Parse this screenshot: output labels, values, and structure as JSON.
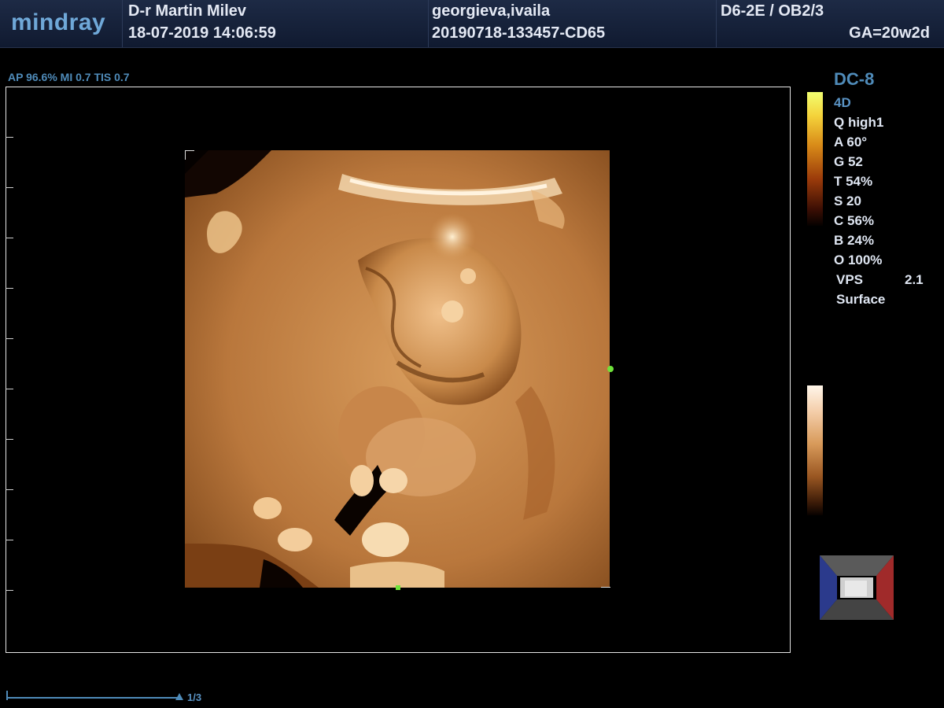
{
  "header": {
    "brand": "mindray",
    "operator": "D-r Martin Milev",
    "datetime": "18-07-2019  14:06:59",
    "patient_name": "georgieva,ivaila",
    "exam_id": "20190718-133457-CD65",
    "probe_preset": "D6-2E / OB2/3",
    "gestational_age": "GA=20w2d"
  },
  "acoustic_output": "AP 96.6%  MI 0.7 TIS 0.7",
  "parameters": {
    "probe": "DC-8",
    "items": [
      {
        "label": "4D",
        "value": ""
      },
      {
        "label": "Q high1",
        "value": ""
      },
      {
        "label": "A 60°",
        "value": ""
      },
      {
        "label": "G 52",
        "value": ""
      },
      {
        "label": "T 54%",
        "value": ""
      },
      {
        "label": "S 20",
        "value": ""
      },
      {
        "label": "C 56%",
        "value": ""
      },
      {
        "label": "B 24%",
        "value": ""
      },
      {
        "label": "O 100%",
        "value": ""
      },
      {
        "label": "VPS",
        "value": "2.1"
      },
      {
        "label": "Surface",
        "value": ""
      }
    ]
  },
  "cine": {
    "page": "1/3"
  },
  "colors": {
    "accent": "#4f8bb9",
    "marker": "#6fe23a",
    "render_tone": "#c98a4a"
  }
}
